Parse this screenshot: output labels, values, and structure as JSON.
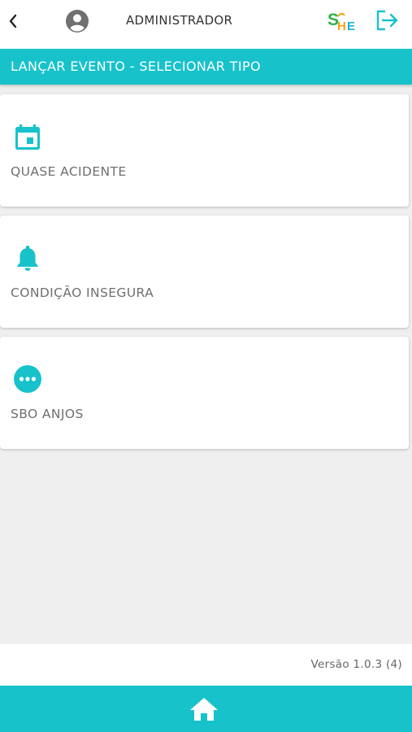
{
  "header": {
    "back_icon": "chevron-left-icon",
    "avatar_icon": "account-circle-icon",
    "user_name": "ADMINISTRADOR",
    "logo_text": "SHE",
    "logout_icon": "logout-icon"
  },
  "section": {
    "title": "LANÇAR EVENTO - SELECIONAR TIPO"
  },
  "event_types": [
    {
      "label": "QUASE ACIDENTE",
      "icon": "calendar-icon"
    },
    {
      "label": "CONDIÇÃO INSEGURA",
      "icon": "bell-icon"
    },
    {
      "label": "SBO ANJOS",
      "icon": "more-horiz-icon"
    }
  ],
  "footer": {
    "version": "Versão 1.0.3 (4)",
    "home_icon": "home-icon"
  },
  "colors": {
    "accent": "#17c2cb",
    "background": "#efefef",
    "card": "#ffffff",
    "label_text": "#6f6f6f"
  }
}
